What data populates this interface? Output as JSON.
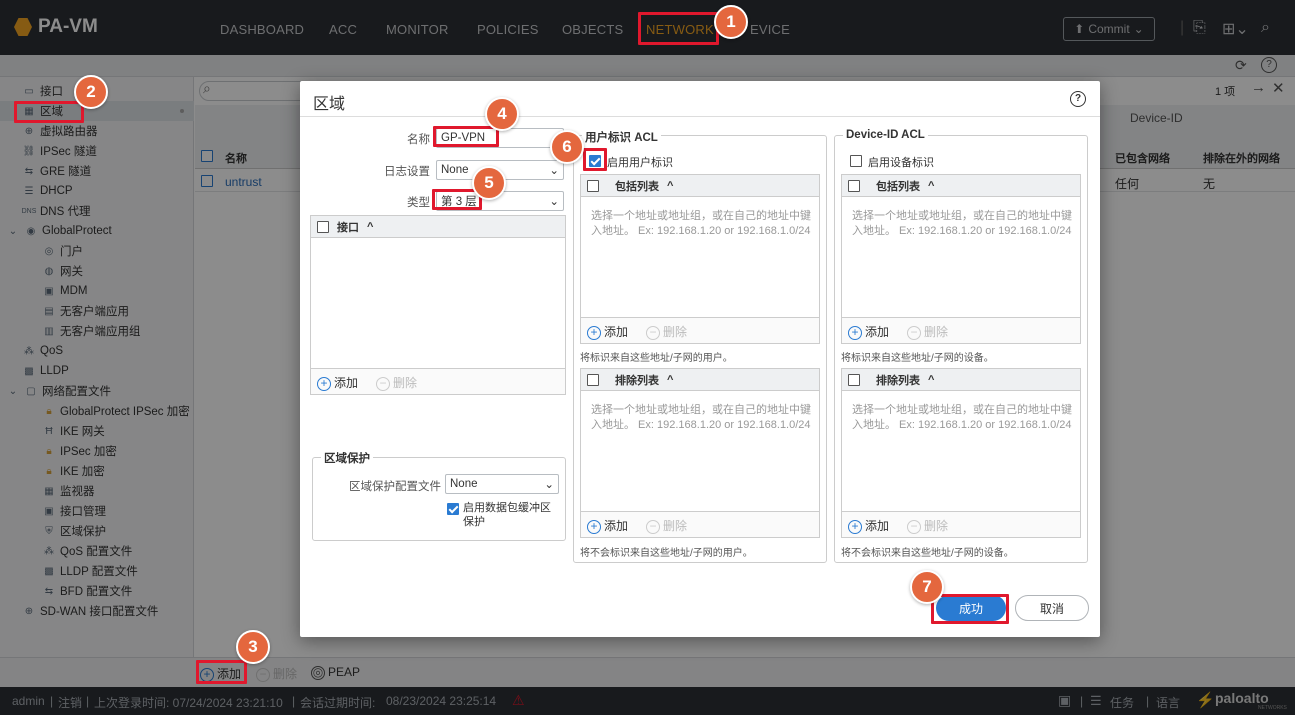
{
  "app": {
    "logo": "PA-VM"
  },
  "nav": {
    "tabs": [
      "DASHBOARD",
      "ACC",
      "MONITOR",
      "POLICIES",
      "OBJECTS",
      "NETWORK",
      "DEVICE"
    ],
    "device_partial": "EVICE",
    "commit": "Commit"
  },
  "sidebar": {
    "items": [
      {
        "label": "接口"
      },
      {
        "label": "区域"
      },
      {
        "label": "虚拟路由器"
      },
      {
        "label": "IPSec 隧道"
      },
      {
        "label": "GRE 隧道"
      },
      {
        "label": "DHCP"
      },
      {
        "label": "DNS 代理"
      },
      {
        "label": "GlobalProtect"
      },
      {
        "label": "门户"
      },
      {
        "label": "网关"
      },
      {
        "label": "MDM"
      },
      {
        "label": "无客户端应用"
      },
      {
        "label": "无客户端应用组"
      },
      {
        "label": "QoS"
      },
      {
        "label": "LLDP"
      },
      {
        "label": "网络配置文件"
      },
      {
        "label": "GlobalProtect IPSec 加密"
      },
      {
        "label": "IKE 网关"
      },
      {
        "label": "IPSec 加密"
      },
      {
        "label": "IKE 加密"
      },
      {
        "label": "监视器"
      },
      {
        "label": "接口管理"
      },
      {
        "label": "区域保护"
      },
      {
        "label": "QoS 配置文件"
      },
      {
        "label": "LLDP 配置文件"
      },
      {
        "label": "BFD 配置文件"
      },
      {
        "label": "SD-WAN 接口配置文件"
      }
    ]
  },
  "table": {
    "count": "1 项",
    "header_name": "名称",
    "group_device_id": "Device-ID",
    "col_included": "已包含网络",
    "col_excluded": "排除在外的网络",
    "row": {
      "name": "untrust",
      "included": "任何",
      "excluded": "无"
    }
  },
  "bottom": {
    "add": "添加",
    "delete": "删除",
    "peap": "PEAP"
  },
  "status": {
    "user": "admin",
    "logout": "注销",
    "last_login": "上次登录时间: 07/24/2024 23:21:10",
    "session_expiry": "会话过期时间:",
    "session_time": "08/23/2024 23:25:14",
    "tasks": "任务",
    "language": "语言",
    "brand": "paloalto",
    "brand_sub": "NETWORKS"
  },
  "dialog": {
    "title": "区域",
    "name_label": "名称",
    "name_value": "GP-VPN",
    "log_label": "日志设置",
    "log_value": "None",
    "type_label": "类型",
    "type_value": "第 3 层",
    "interface_header": "接口",
    "add": "添加",
    "delete": "删除",
    "zone_protection": {
      "title": "区域保护",
      "profile_label": "区域保护配置文件",
      "profile_value": "None",
      "buffering_label": "启用数据包缓冲区保护"
    },
    "user_acl": {
      "title": "用户标识 ACL",
      "enable_label": "启用用户标识",
      "include_header": "包括列表",
      "exclude_header": "排除列表",
      "placeholder": "选择一个地址或地址组，或在自己的地址中键入地址。 Ex: 192.168.1.20 or 192.168.1.0/24",
      "include_note": "将标识来自这些地址/子网的用户。",
      "exclude_note": "将不会标识来自这些地址/子网的用户。"
    },
    "device_acl": {
      "title": "Device-ID ACL",
      "enable_label": "启用设备标识",
      "include_header": "包括列表",
      "exclude_header": "排除列表",
      "placeholder": "选择一个地址或地址组，或在自己的地址中键入地址。 Ex: 192.168.1.20 or 192.168.1.0/24",
      "include_note": "将标识来自这些地址/子网的设备。",
      "exclude_note": "将不会标识来自这些地址/子网的设备。"
    },
    "ok": "成功",
    "cancel": "取消"
  },
  "steps": [
    "1",
    "2",
    "3",
    "4",
    "5",
    "6",
    "7"
  ],
  "colors": {
    "accent": "#f5a623",
    "highlight": "#e0182d",
    "badge": "#e4673e",
    "primary": "#2a7bd2"
  }
}
